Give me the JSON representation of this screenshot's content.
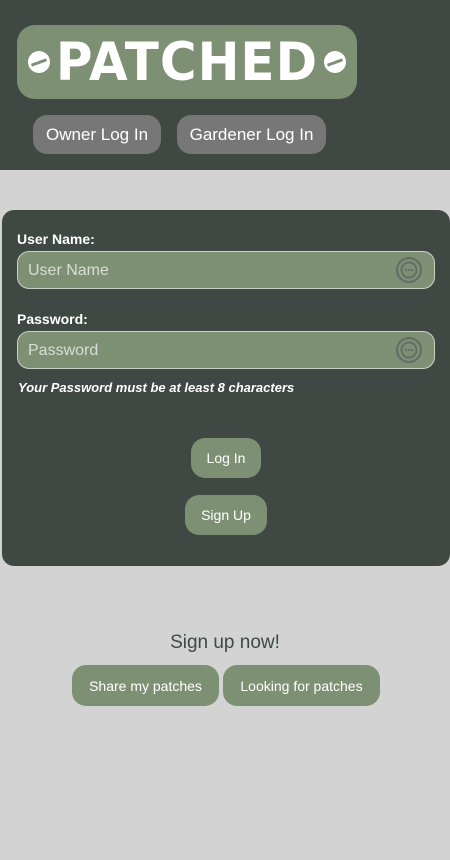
{
  "header": {
    "logo_text": "PATCHED",
    "owner_login": "Owner Log In",
    "gardener_login": "Gardener Log In"
  },
  "form": {
    "username_label": "User Name:",
    "username_placeholder": "User Name",
    "username_value": "",
    "password_label": "Password:",
    "password_placeholder": "Password",
    "password_value": "",
    "password_hint": "Your Password must be at least 8 characters",
    "login_button": "Log In",
    "signup_button": "Sign Up",
    "field_icon": "password-manager-icon"
  },
  "cta": {
    "title": "Sign up now!",
    "share_button": "Share my patches",
    "looking_button": "Looking for patches"
  },
  "colors": {
    "header_bg": "#404843",
    "accent_green": "#7e9074",
    "page_bg": "#d3d3d3",
    "gray_button": "#777777"
  }
}
